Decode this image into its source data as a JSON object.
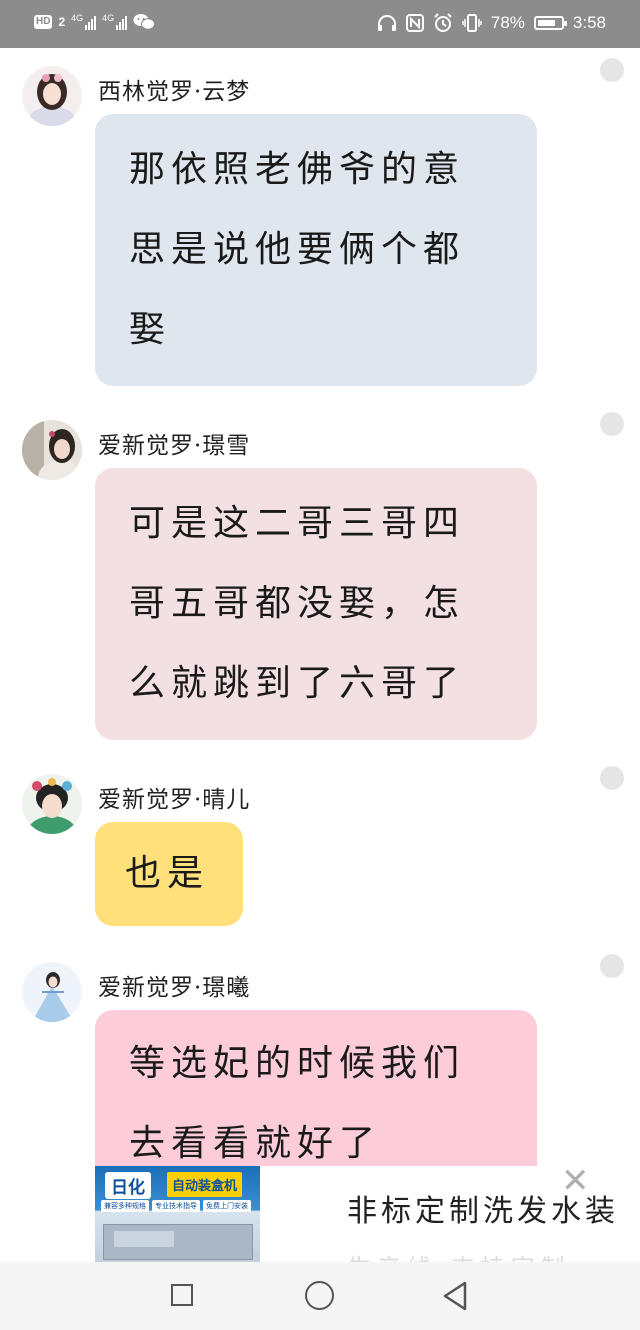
{
  "status_bar": {
    "hd": "HD",
    "sim": "2",
    "net1": "4G",
    "net2": "4G",
    "battery_percent": "78%",
    "battery_level": 0.78,
    "time": "3:58"
  },
  "messages": [
    {
      "sender": "西林觉罗·云梦",
      "lines": [
        "那依照老佛爷的意",
        "思是说他要俩个都",
        "娶"
      ],
      "bubble_color": "#e0e6ee"
    },
    {
      "sender": "爱新觉罗·璟雪",
      "lines": [
        "可是这二哥三哥四",
        "哥五哥都没娶，怎",
        "么就跳到了六哥了"
      ],
      "bubble_color": "#f3e0e2"
    },
    {
      "sender": "爱新觉罗·晴儿",
      "lines": [
        "也是"
      ],
      "bubble_color": "#ffe07a"
    },
    {
      "sender": "爱新觉罗·璟曦",
      "lines": [
        "等选妃的时候我们",
        "去看看就好了"
      ],
      "bubble_color": "#fccdd9"
    }
  ],
  "ad": {
    "brand": "日化",
    "tag": "自动装盒机",
    "features": [
      "兼容多种规格",
      "专业技术指导",
      "免费上门安装"
    ],
    "title": "非标定制洗发水装",
    "subtitle": "生产线 支持定制",
    "close_icon": "close-icon"
  },
  "nav": {
    "recents": "square-icon",
    "home": "circle-icon",
    "back": "triangle-back-icon"
  }
}
